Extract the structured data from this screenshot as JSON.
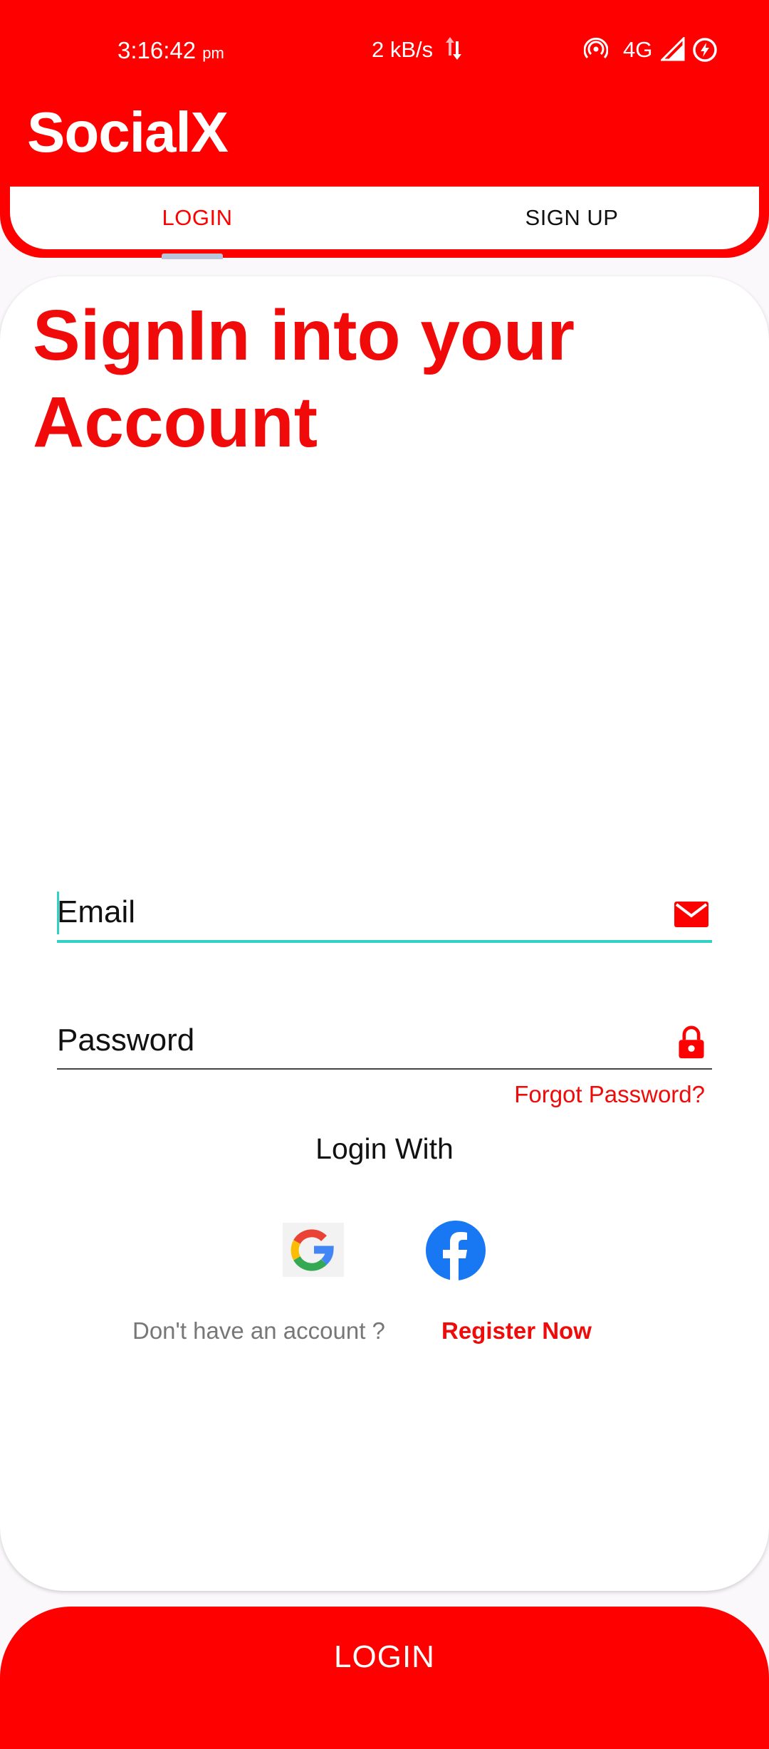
{
  "status_bar": {
    "time": "3:16:42",
    "ampm": "pm",
    "net_speed": "2 kB/s",
    "network_type": "4G",
    "icons": [
      "data-arrows-icon",
      "hotspot-icon",
      "signal-icon",
      "battery-saver-icon"
    ]
  },
  "app": {
    "title": "SocialX"
  },
  "tabs": {
    "login": "LOGIN",
    "signup": "SIGN UP",
    "active": "login"
  },
  "headline": {
    "line1": "SignIn into your",
    "line2": "Account"
  },
  "form": {
    "email_placeholder": "Email",
    "password_placeholder": "Password",
    "forgot": "Forgot Password?",
    "login_with": "Login With",
    "social": [
      "google-icon",
      "facebook-icon"
    ],
    "no_account": "Don't have an account ?",
    "register": "Register Now"
  },
  "login_button": "LOGIN",
  "colors": {
    "primary": "#ff0000",
    "focus": "#2fd2c4",
    "facebook": "#1877f2"
  }
}
